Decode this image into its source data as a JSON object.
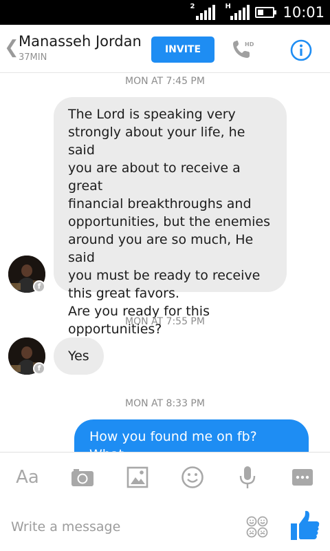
{
  "status_bar": {
    "time": "10:01",
    "signal1_label": "2",
    "signal2_label": "H"
  },
  "header": {
    "back_icon": "chevron-left-icon",
    "contact_name": "Manasseh Jordan",
    "contact_status": "37MIN",
    "invite_label": "INVITE",
    "call_badge": "HD",
    "info_icon": "info-icon"
  },
  "conversation": {
    "timestamps": [
      "MON AT 7:45 PM",
      "MON AT 7:55 PM",
      "MON AT 8:33 PM"
    ],
    "messages": [
      {
        "direction": "incoming",
        "text": "The Lord is speaking very\nstrongly about your life, he said\nyou are about to receive a great\nfinancial breakthroughs and\nopportunities, but the enemies\naround you are so much, He said\nyou must be ready to receive\nthis great favors.\nAre you ready for this\nopportunities?"
      },
      {
        "direction": "incoming",
        "text": "Yes"
      },
      {
        "direction": "outgoing",
        "text": "How you found me on fb? What"
      }
    ],
    "avatar_badge": "f"
  },
  "toolbar": {
    "text_format_label": "Aa",
    "icons": [
      "camera-icon",
      "image-icon",
      "sticker-icon",
      "microphone-icon",
      "more-icon"
    ]
  },
  "composer": {
    "placeholder": "Write a message",
    "value": ""
  },
  "colors": {
    "accent": "#1e8df3",
    "incoming_bubble": "#ebebeb",
    "muted_text": "#8c8c8c"
  }
}
